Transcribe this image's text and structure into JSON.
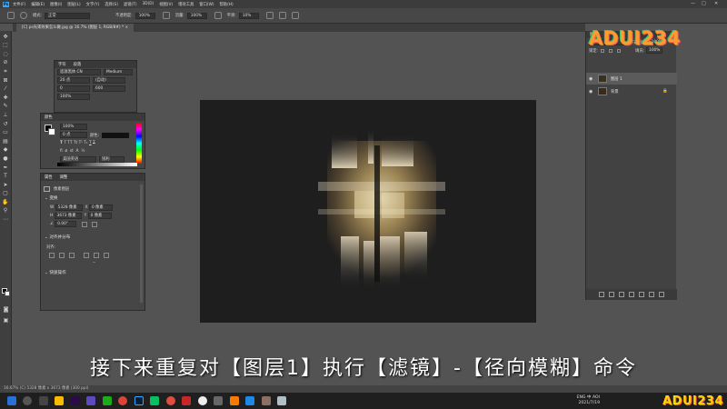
{
  "menubar": {
    "items": [
      "文件(F)",
      "编辑(E)",
      "图像(I)",
      "图层(L)",
      "文字(Y)",
      "选择(S)",
      "滤镜(T)",
      "3D(D)",
      "视图(V)",
      "增效工具",
      "窗口(W)",
      "帮助(H)"
    ],
    "minimize": "—",
    "maximize": "□",
    "close": "✕"
  },
  "optbar": {
    "mode_label": "模式:",
    "mode_value": "正常",
    "opacity_label": "不透明度:",
    "opacity_value": "100%",
    "flow_label": "流量:",
    "flow_value": "100%",
    "smooth_label": "平滑:",
    "smooth_value": "10%"
  },
  "document": {
    "tab_title": "[C] ps光束效果怎么做.jpg @ 16.7% (图层 1, RGB/8#) *  ×"
  },
  "char_panel": {
    "tabs": [
      "字符",
      "段落"
    ],
    "font_family": "思源黑体 CN",
    "font_style": "Medium",
    "font_size": "20 点",
    "leading": "(自动)",
    "kerning": "0",
    "tracking": "600",
    "scale_v": "100%",
    "scale_h": "100%",
    "baseline": "0 点",
    "color_label": "颜色:",
    "language": "美国英语",
    "aa": "锐利"
  },
  "color_panel": {
    "tab": "颜色"
  },
  "props_panel": {
    "tabs": [
      "属性",
      "调整"
    ],
    "layer_type": "像素图层",
    "transform_title": "变换",
    "w_label": "W",
    "w_value": "5328 像素",
    "h_label": "H",
    "h_value": "3673 像素",
    "x_label": "X",
    "x_value": "0 像素",
    "y_label": "Y",
    "y_value": "0 像素",
    "angle_value": "0.00°",
    "align_title": "对齐并分布",
    "align_sub": "对齐:",
    "quick_title": "快速操作",
    "more": "···"
  },
  "layers_panel": {
    "tab": "图层",
    "blend_mode": "正常",
    "opacity_label": "不透明度:",
    "opacity_value": "100%",
    "lock_label": "锁定:",
    "fill_label": "填充:",
    "fill_value": "100%",
    "layers": [
      {
        "name": "图层 1"
      },
      {
        "name": "背景",
        "lock": "🔒"
      }
    ]
  },
  "watermark": {
    "top_logo": "ADUI234",
    "bottom_logo": "ADUI234"
  },
  "subtitle": "接下来重复对【图层1】执行【滤镜】-【径向模糊】命令",
  "status": {
    "text": "16.67%   (C) 5328 像素 x 3673 像素 (300 ppi)"
  },
  "taskbar": {
    "tray_top": "ENG 中 AOI",
    "tray_date": "2021/7/19"
  },
  "colors": {
    "ps_blue": "#31a8ff",
    "canvas_bg": "#1e1e1e",
    "app_bg": "#535353",
    "watermark_colors": [
      "#ff5a5a",
      "#ff9b2e",
      "#ffd400",
      "#38c86a",
      "#2fb6ff",
      "#b46cff"
    ]
  }
}
